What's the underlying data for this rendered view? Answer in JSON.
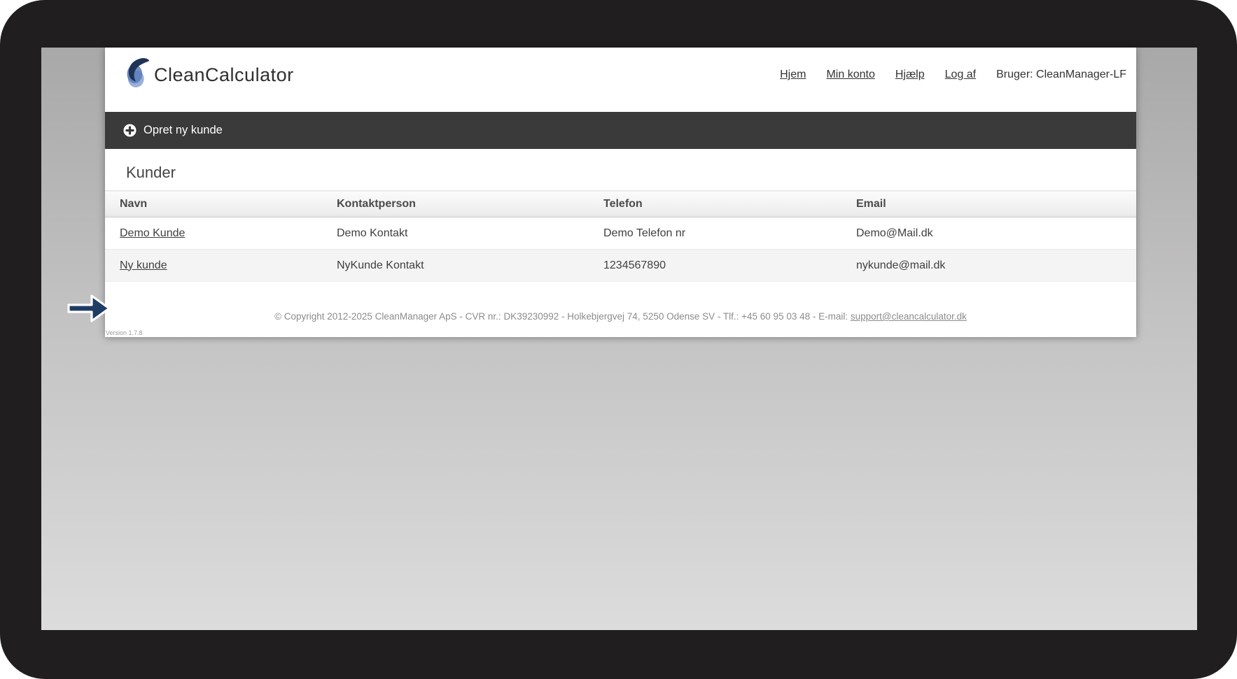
{
  "header": {
    "logo_text": "CleanCalculator",
    "nav": [
      "Hjem",
      "Min konto",
      "Hjælp",
      "Log af"
    ],
    "user_label": "Bruger: CleanManager-LF"
  },
  "action_bar": {
    "label": "Opret ny kunde",
    "icon": "plus-circle-icon"
  },
  "page": {
    "title": "Kunder"
  },
  "table": {
    "columns": [
      "Navn",
      "Kontaktperson",
      "Telefon",
      "Email"
    ],
    "rows": [
      {
        "navn": "Demo Kunde",
        "kontaktperson": "Demo Kontakt",
        "telefon": "Demo Telefon nr",
        "email": "Demo@Mail.dk"
      },
      {
        "navn": "Ny kunde",
        "kontaktperson": "NyKunde Kontakt",
        "telefon": "1234567890",
        "email": "nykunde@mail.dk"
      }
    ]
  },
  "footer": {
    "copyright": "© Copyright 2012-2025 CleanManager ApS - CVR nr.: DK39230992 - Holkebjergvej 74, 5250 Odense SV - Tlf.: +45 60 95 03 48 - E-mail:",
    "support_email": "support@cleancalculator.dk"
  },
  "version": "Version 1.7.8",
  "colors": {
    "frame_black": "#201e1f",
    "action_bar_bg": "#3a3a3a",
    "logo_navy": "#1d3455",
    "logo_blue": "#5b7cb8",
    "logo_light_blue": "#8fa9d6",
    "annotation_arrow": "#1e3c64",
    "row_alt_bg": "#f4f4f4"
  }
}
